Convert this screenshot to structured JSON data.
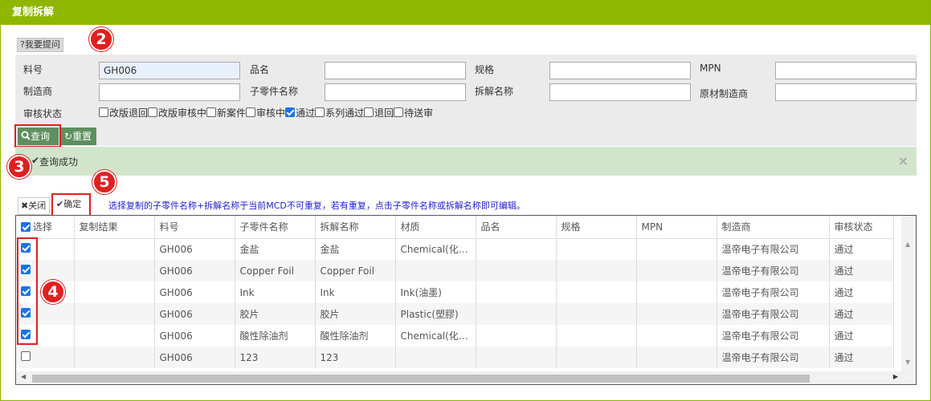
{
  "dialog": {
    "title": "复制拆解",
    "help_label": "?我要提问"
  },
  "form": {
    "part_no_label": "料号",
    "part_no_value": "GH006",
    "product_name_label": "品名",
    "spec_label": "规格",
    "mpn_label": "MPN",
    "manufacturer_label": "制造商",
    "sub_part_name_label": "子零件名称",
    "dismantle_name_label": "拆解名称",
    "orig_manufacturer_label": "原材制造商",
    "review_status_label": "审核状态",
    "statuses": [
      {
        "label": "改版退回",
        "checked": false
      },
      {
        "label": "改版审核中",
        "checked": false
      },
      {
        "label": "新案件",
        "checked": false
      },
      {
        "label": "审核中",
        "checked": false
      },
      {
        "label": "通过",
        "checked": true
      },
      {
        "label": "系列通过",
        "checked": false
      },
      {
        "label": "退回",
        "checked": false
      },
      {
        "label": "待送审",
        "checked": false
      }
    ],
    "query_label": "查询",
    "reset_label": "重置"
  },
  "message": {
    "text": "查询成功",
    "close": "×"
  },
  "toolbar": {
    "close_label": "关闭",
    "confirm_label": "确定",
    "note": "选择复制的子零件名称+拆解名称于当前MCD不可重复，若有重复，点击子零件名称或拆解名称即可编辑。"
  },
  "annotations": [
    "2",
    "3",
    "4",
    "5"
  ],
  "table": {
    "columns": [
      "选择",
      "复制结果",
      "料号",
      "子零件名称",
      "拆解名称",
      "材质",
      "品名",
      "规格",
      "MPN",
      "制造商",
      "审核状态"
    ],
    "rows": [
      {
        "checked": true,
        "cells": [
          "",
          "GH006",
          "金盐",
          "金盐",
          "Chemical(化…",
          "",
          "",
          "",
          "温帝电子有限公司",
          "通过"
        ]
      },
      {
        "checked": true,
        "cells": [
          "",
          "GH006",
          "Copper Foil",
          "Copper Foil",
          "",
          "",
          "",
          "",
          "温帝电子有限公司",
          "通过"
        ]
      },
      {
        "checked": true,
        "cells": [
          "",
          "GH006",
          "Ink",
          "Ink",
          "Ink(油墨)",
          "",
          "",
          "",
          "温帝电子有限公司",
          "通过"
        ]
      },
      {
        "checked": true,
        "cells": [
          "",
          "GH006",
          "胶片",
          "胶片",
          "Plastic(塑膠)",
          "",
          "",
          "",
          "温帝电子有限公司",
          "通过"
        ]
      },
      {
        "checked": true,
        "cells": [
          "",
          "GH006",
          "酸性除油剂",
          "酸性除油剂",
          "Chemical(化…",
          "",
          "",
          "",
          "温帝电子有限公司",
          "通过"
        ]
      },
      {
        "checked": false,
        "cells": [
          "",
          "GH006",
          "123",
          "123",
          "",
          "",
          "",
          "",
          "温帝电子有限公司",
          "通过"
        ]
      }
    ]
  }
}
